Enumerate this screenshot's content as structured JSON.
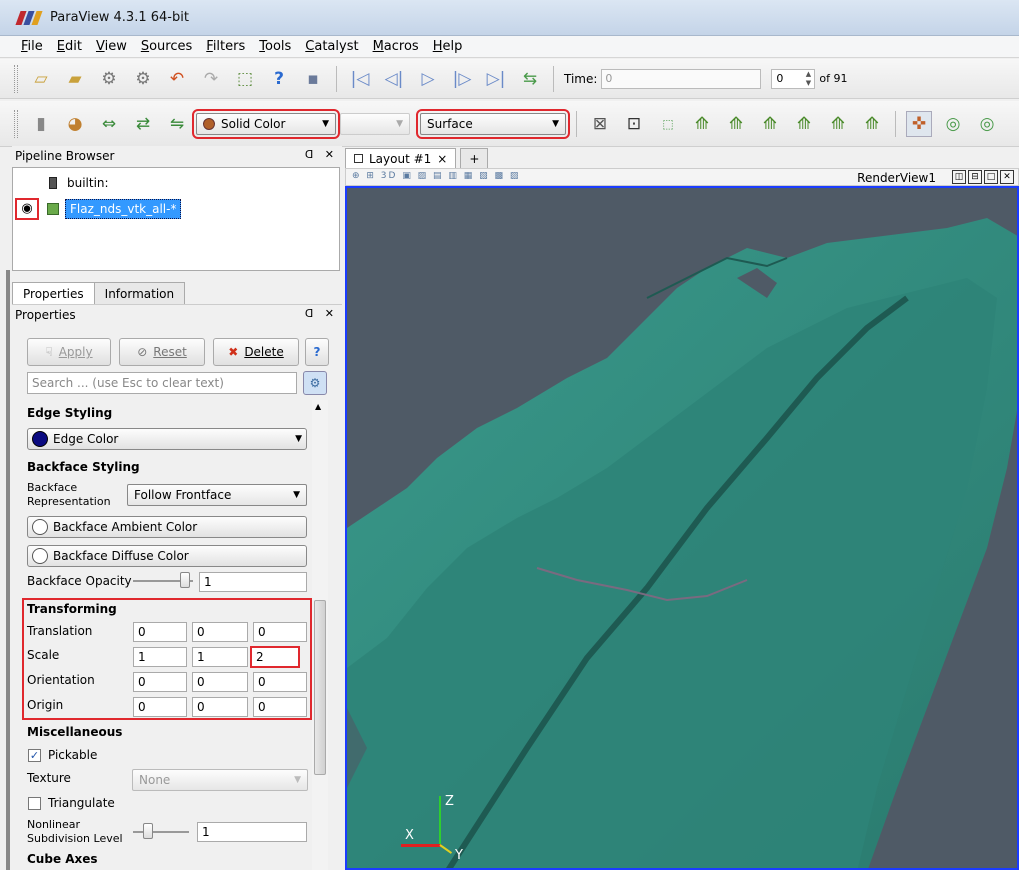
{
  "window": {
    "title": "ParaView 4.3.1 64-bit"
  },
  "menu": [
    {
      "label": "File",
      "u": "F",
      "rest": "ile"
    },
    {
      "label": "Edit",
      "u": "E",
      "rest": "dit"
    },
    {
      "label": "View",
      "u": "V",
      "rest": "iew"
    },
    {
      "label": "Sources",
      "u": "S",
      "rest": "ources"
    },
    {
      "label": "Filters",
      "u": "F",
      "rest": "ilters"
    },
    {
      "label": "Tools",
      "u": "T",
      "rest": "ools"
    },
    {
      "label": "Catalyst",
      "u": "C",
      "rest": "atalyst"
    },
    {
      "label": "Macros",
      "u": "M",
      "rest": "acros"
    },
    {
      "label": "Help",
      "u": "H",
      "rest": "elp"
    }
  ],
  "time": {
    "label": "Time:",
    "value": "0",
    "frame": "0",
    "of_label": "of 91"
  },
  "toolbar2": {
    "color_combo": "Solid Color",
    "representation_combo": "Surface"
  },
  "pipeline": {
    "title": "Pipeline Browser",
    "items": [
      {
        "label": "builtin:"
      },
      {
        "label": "Flaz_nds_vtk_all-*"
      }
    ]
  },
  "tabs": {
    "properties": "Properties",
    "information": "Information"
  },
  "properties": {
    "title": "Properties",
    "apply": "Apply",
    "reset": "Reset",
    "delete": "Delete",
    "help": "?",
    "search_placeholder": "Search ... (use Esc to clear text)",
    "edge_styling": "Edge Styling",
    "edge_color": "Edge Color",
    "backface_styling": "Backface Styling",
    "backface_rep_label": "Backface\nRepresentation",
    "backface_rep_value": "Follow Frontface",
    "backface_ambient": "Backface Ambient Color",
    "backface_diffuse": "Backface Diffuse Color",
    "backface_opacity_label": "Backface Opacity",
    "backface_opacity": "1",
    "transforming": "Transforming",
    "translation_label": "Translation",
    "translation": [
      "0",
      "0",
      "0"
    ],
    "scale_label": "Scale",
    "scale": [
      "1",
      "1",
      "2"
    ],
    "orientation_label": "Orientation",
    "orientation": [
      "0",
      "0",
      "0"
    ],
    "origin_label": "Origin",
    "origin": [
      "0",
      "0",
      "0"
    ],
    "miscellaneous": "Miscellaneous",
    "pickable": "Pickable",
    "texture_label": "Texture",
    "texture_value": "None",
    "triangulate": "Triangulate",
    "nonlinear_label": "Nonlinear\nSubdivision Level",
    "nonlinear_value": "1",
    "cube_axes": "Cube Axes"
  },
  "layout": {
    "tab_label": "Layout #1",
    "close": "×",
    "plus": "+",
    "render_view": "RenderView1"
  },
  "axes": {
    "x": "X",
    "y": "Y",
    "z": "Z"
  },
  "colors": {
    "surface": "#2f8a7e",
    "background": "#4f5a66",
    "selection": "#3399ff",
    "highlight": "#e0282e"
  }
}
